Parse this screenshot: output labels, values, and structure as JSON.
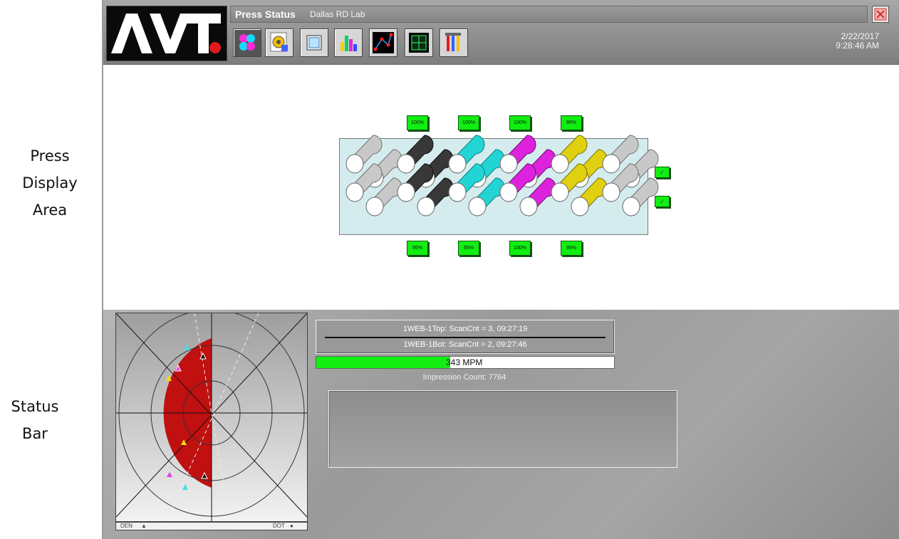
{
  "annotations": {
    "press_display_area": [
      "Press",
      "Display",
      "Area"
    ],
    "status_bar": [
      "Status",
      "Bar"
    ]
  },
  "header": {
    "logo_text": "AVT.",
    "title": "Press Status",
    "location": "Dallas RD Lab",
    "date": "2/22/2017",
    "time": "9:28:46 AM",
    "toolbar": [
      "press-status",
      "settings",
      "window",
      "bar-chart",
      "scatter-plot",
      "frame-view",
      "tools"
    ]
  },
  "press": {
    "units": [
      {
        "color": "#c8c8c8",
        "shade": "#707070"
      },
      {
        "color": "#383838",
        "shade": "#101010"
      },
      {
        "color": "#23d4d4",
        "shade": "#0a7f7f"
      },
      {
        "color": "#dd22dd",
        "shade": "#6a0a6a"
      },
      {
        "color": "#e0d010",
        "shade": "#7a7000"
      },
      {
        "color": "#c8c8c8",
        "shade": "#707070"
      }
    ],
    "top_percent": [
      "100%",
      "100%",
      "100%",
      "95%"
    ],
    "bottom_percent": [
      "95%",
      "95%",
      "100%",
      "95%"
    ],
    "check_icon": "check-circle-icon"
  },
  "status": {
    "scan_top": "1WEB-1Top: ScanCnt = 3, 09:27:19",
    "scan_bottom": "1WEB-1Bot: ScanCnt = 2, 09:27:46",
    "speed_label": "343 MPM",
    "speed_fill_fraction": 0.45,
    "impression": "Impression Count: 7764",
    "radar": {
      "den_label": "DEN",
      "dot_label": "DOT"
    }
  },
  "colors": {
    "accent_green": "#11ee11",
    "radar_red": "#c01010",
    "close_red": "#e04040"
  }
}
